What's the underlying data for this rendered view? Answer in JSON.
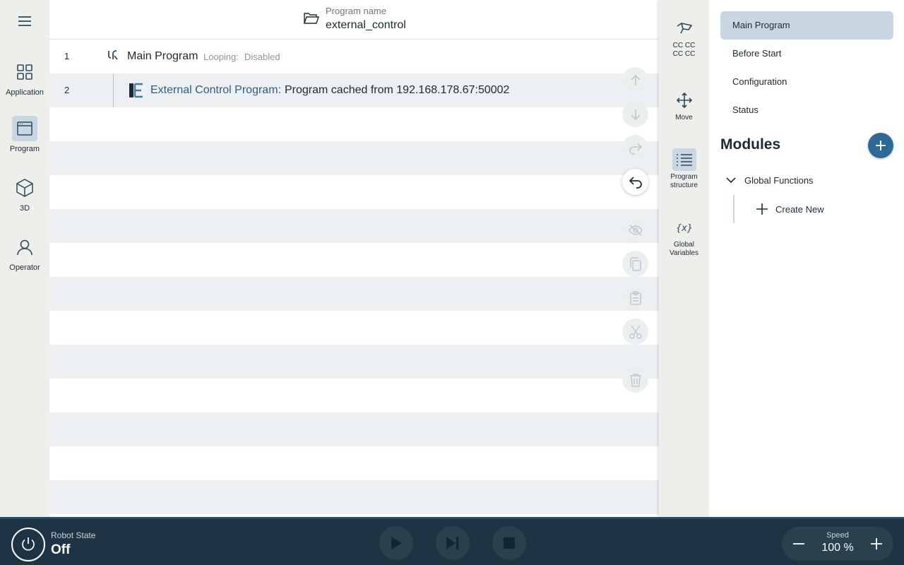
{
  "leftnav": {
    "items": [
      {
        "label": "Application",
        "icon": "grid-icon"
      },
      {
        "label": "Program",
        "icon": "program-window-icon",
        "active": true
      },
      {
        "label": "3D",
        "icon": "cube-icon"
      },
      {
        "label": "Operator",
        "icon": "person-icon"
      }
    ]
  },
  "header": {
    "program_name_label": "Program name",
    "program_name": "external_control"
  },
  "program": {
    "rows": [
      {
        "line": "1",
        "title": "Main Program",
        "looping_label": "Looping:",
        "looping_value": "Disabled"
      },
      {
        "line": "2",
        "label": "External Control Program:",
        "value": "Program cached from 192.168.178.67:50002"
      },
      {
        "line": ""
      },
      {
        "line": ""
      },
      {
        "line": ""
      },
      {
        "line": ""
      },
      {
        "line": ""
      },
      {
        "line": ""
      },
      {
        "line": ""
      },
      {
        "line": ""
      },
      {
        "line": ""
      },
      {
        "line": ""
      },
      {
        "line": ""
      },
      {
        "line": ""
      }
    ]
  },
  "tools": [
    "move-up-icon",
    "move-down-icon",
    "redo-icon",
    "undo-icon",
    "hide-icon",
    "copy-icon",
    "paste-icon",
    "cut-icon",
    "delete-icon"
  ],
  "rail": {
    "items": [
      {
        "label": "CC CC CC CC",
        "icon": "teach-pendant-icon"
      },
      {
        "label": "Move",
        "icon": "move-arrows-icon"
      },
      {
        "label": "Program structure",
        "icon": "list-icon",
        "active": true
      },
      {
        "label": "Global Variables",
        "icon": "variables-icon"
      }
    ]
  },
  "panel": {
    "items": [
      {
        "label": "Main Program",
        "active": true
      },
      {
        "label": "Before Start"
      },
      {
        "label": "Configuration"
      },
      {
        "label": "Status"
      }
    ],
    "modules_title": "Modules",
    "global_functions": "Global Functions",
    "create_new": "Create New"
  },
  "bottombar": {
    "robot_state_label": "Robot State",
    "robot_state_value": "Off",
    "speed_label": "Speed",
    "speed_value": "100 %"
  },
  "colors": {
    "accent": "#2d6a98",
    "bottom_bar": "#1e3445",
    "active_highlight": "#c9d7e2",
    "external_control_text": "#2d5d80"
  }
}
